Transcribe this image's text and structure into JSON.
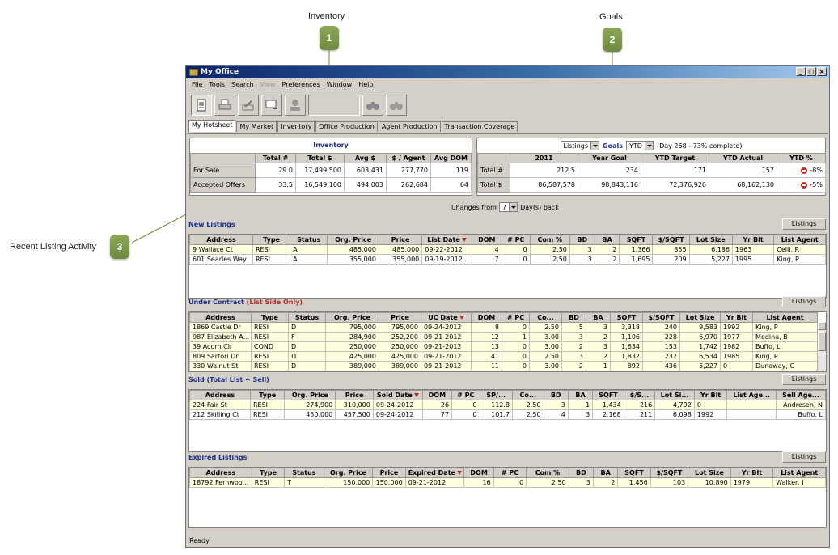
{
  "annotations": {
    "inventory_label": "Inventory",
    "goals_label": "Goals",
    "recent_label": "Recent Listing Activity",
    "badge1": "1",
    "badge2": "2",
    "badge3": "3"
  },
  "window": {
    "title": "My Office",
    "min": "_",
    "max": "□",
    "close": "×"
  },
  "menu": [
    "File",
    "Tools",
    "Search",
    "View",
    "Preferences",
    "Window",
    "Help"
  ],
  "tabs": [
    "My Hotsheet",
    "My Market",
    "Inventory",
    "Office Production",
    "Agent Production",
    "Transaction Coverage"
  ],
  "inventory": {
    "title": "Inventory",
    "headers": [
      "",
      "Total #",
      "Total $",
      "Avg $",
      "$ / Agent",
      "Avg DOM"
    ],
    "rows": [
      [
        "For Sale",
        "29.0",
        "17,499,500",
        "603,431",
        "277,770",
        "119"
      ],
      [
        "Accepted Offers",
        "33.5",
        "16,549,100",
        "494,003",
        "262,684",
        "64"
      ]
    ]
  },
  "goals": {
    "listings_select": "Listings",
    "label": "Goals",
    "period_select": "YTD",
    "day_text": "(Day 268 - 73% complete)",
    "headers": [
      "",
      "2011",
      "Year Goal",
      "YTD Target",
      "YTD Actual",
      "YTD %"
    ],
    "rows": [
      [
        "Total #",
        "212.5",
        "234",
        "171",
        "157",
        "-8%"
      ],
      [
        "Total $",
        "86,587,578",
        "98,843,116",
        "72,376,926",
        "68,162,130",
        "-5%"
      ]
    ]
  },
  "changes": {
    "prefix": "Changes from",
    "value": "7",
    "suffix": "Day(s) back"
  },
  "new_listings": {
    "title": "New Listings",
    "button": "Listings",
    "headers": [
      "Address",
      "Type",
      "Status",
      "Org. Price",
      "Price",
      "List Date",
      "DOM",
      "# PC",
      "Com %",
      "BD",
      "BA",
      "SQFT",
      "$/SQFT",
      "Lot Size",
      "Yr Blt",
      "List Agent"
    ],
    "rows": [
      [
        "9 Wallace Ct",
        "RESI",
        "A",
        "485,000",
        "485,000",
        "09-22-2012",
        "4",
        "0",
        "2.50",
        "3",
        "2",
        "1,366",
        "355",
        "6,186",
        "1963",
        "Celli, R"
      ],
      [
        "601 Searles Way",
        "RESI",
        "A",
        "355,000",
        "355,000",
        "09-19-2012",
        "7",
        "0",
        "2.50",
        "3",
        "2",
        "1,695",
        "209",
        "5,227",
        "1995",
        "King, P"
      ]
    ]
  },
  "under_contract": {
    "title": "Under Contract",
    "title_red": "(List Side Only)",
    "button": "Listings",
    "headers": [
      "Address",
      "Type",
      "Status",
      "Org. Price",
      "Price",
      "UC Date",
      "DOM",
      "# PC",
      "Co...",
      "BD",
      "BA",
      "SQFT",
      "$/SQFT",
      "Lot Size",
      "Yr Blt",
      "List Agent"
    ],
    "rows": [
      [
        "1869 Castle Dr",
        "RESI",
        "D",
        "795,000",
        "795,000",
        "09-24-2012",
        "8",
        "0",
        "2.50",
        "5",
        "3",
        "3,318",
        "240",
        "9,583",
        "1992",
        "King, P"
      ],
      [
        "987 Elizabeth A...",
        "RESI",
        "F",
        "284,900",
        "252,200",
        "09-21-2012",
        "12",
        "1",
        "3.00",
        "3",
        "2",
        "1,106",
        "228",
        "6,970",
        "1977",
        "Medina, B"
      ],
      [
        "39 Acorn Cir",
        "COND",
        "D",
        "250,000",
        "250,000",
        "09-21-2012",
        "13",
        "0",
        "3.00",
        "2",
        "3",
        "1,634",
        "153",
        "1,742",
        "1982",
        "Buffo, L"
      ],
      [
        "809 Sartori Dr",
        "RESI",
        "D",
        "425,000",
        "425,000",
        "09-21-2012",
        "41",
        "0",
        "2.50",
        "3",
        "2",
        "1,832",
        "232",
        "6,534",
        "1985",
        "King, P"
      ],
      [
        "330 Walnut St",
        "RESI",
        "D",
        "389,000",
        "389,000",
        "09-21-2012",
        "11",
        "0",
        "3.00",
        "2",
        "1",
        "892",
        "436",
        "5,227",
        "0",
        "Dunaway, C"
      ]
    ]
  },
  "sold": {
    "title": "Sold (Total List + Sell)",
    "button": "Listings",
    "headers": [
      "Address",
      "Type",
      "Org. Price",
      "Price",
      "Sold Date",
      "DOM",
      "# PC",
      "SP/...",
      "Co...",
      "BD",
      "BA",
      "SQFT",
      "$/S...",
      "Lot Si...",
      "Yr Blt",
      "List Age...",
      "Sell Age..."
    ],
    "rows": [
      [
        "224 Fair St",
        "RESI",
        "274,900",
        "310,000",
        "09-24-2012",
        "26",
        "0",
        "112.8",
        "2.50",
        "3",
        "1",
        "1,434",
        "216",
        "4,792",
        "0",
        "",
        "Andresen, N"
      ],
      [
        "212 Skilling Ct",
        "RESI",
        "450,000",
        "457,500",
        "09-24-2012",
        "77",
        "0",
        "101.7",
        "2.50",
        "4",
        "3",
        "2,168",
        "211",
        "6,098",
        "1992",
        "",
        "Buffo, L"
      ]
    ]
  },
  "expired": {
    "title": "Expired Listings",
    "button": "Listings",
    "headers": [
      "Address",
      "Type",
      "Status",
      "Org. Price",
      "Price",
      "Expired Date",
      "DOM",
      "# PC",
      "Com %",
      "BD",
      "BA",
      "SQFT",
      "$/SQFT",
      "Lot Size",
      "Yr Blt",
      "List Agent"
    ],
    "rows": [
      [
        "18792 Fernwoo...",
        "RESI",
        "T",
        "150,000",
        "150,000",
        "09-21-2012",
        "16",
        "0",
        "2.50",
        "3",
        "2",
        "1,456",
        "103",
        "10,890",
        "1979",
        "Walker, J"
      ]
    ]
  },
  "status_bar": "Ready",
  "colors": {
    "section_title": "#1d2f8a",
    "accent_red": "#b03030",
    "title_bar": "#0a246a",
    "badge": "#7a9647"
  }
}
